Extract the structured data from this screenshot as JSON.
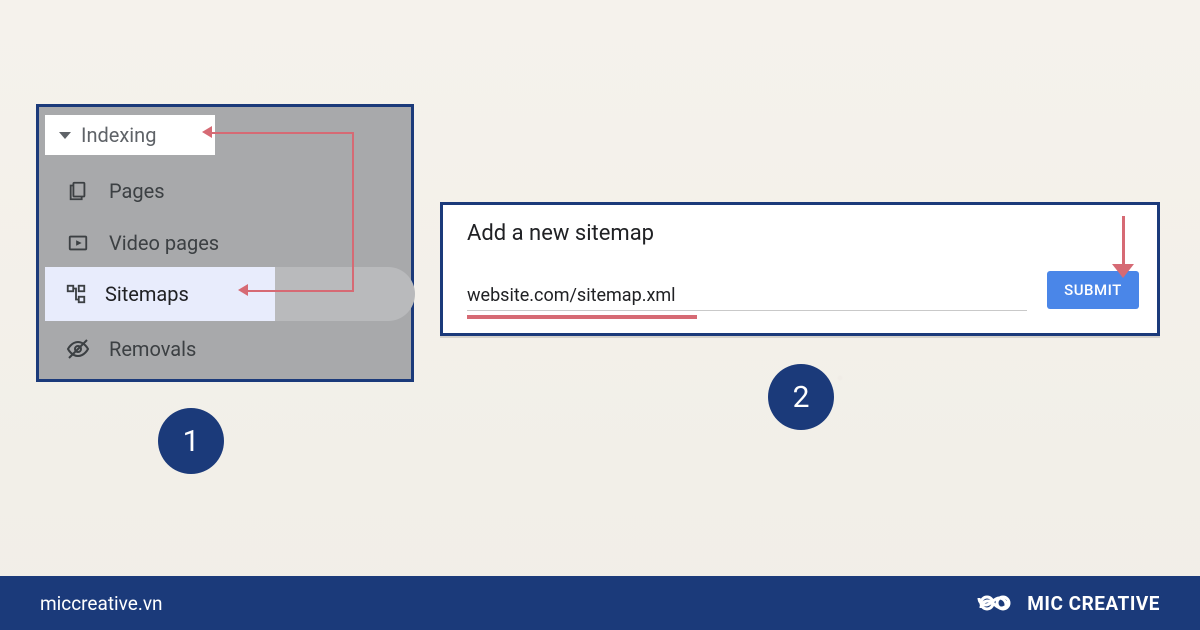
{
  "sidebar": {
    "section_label": "Indexing",
    "items": {
      "pages": {
        "label": "Pages"
      },
      "video": {
        "label": "Video pages"
      },
      "sitemaps": {
        "label": "Sitemaps"
      },
      "removals": {
        "label": "Removals"
      }
    }
  },
  "add_sitemap": {
    "title": "Add a new sitemap",
    "url_value": "website.com/sitemap.xml",
    "submit_label": "SUBMIT"
  },
  "annotations": {
    "step1": "1",
    "step2": "2"
  },
  "footer": {
    "site": "miccreative.vn",
    "brand": "MIC CREATIVE"
  },
  "colors": {
    "frame_blue": "#1b3a7a",
    "accent_blue": "#4a86e8",
    "arrow_pink": "#d66a74",
    "sidebar_grey": "#a8a9ab",
    "highlight_lilac": "#e8ecfc"
  }
}
